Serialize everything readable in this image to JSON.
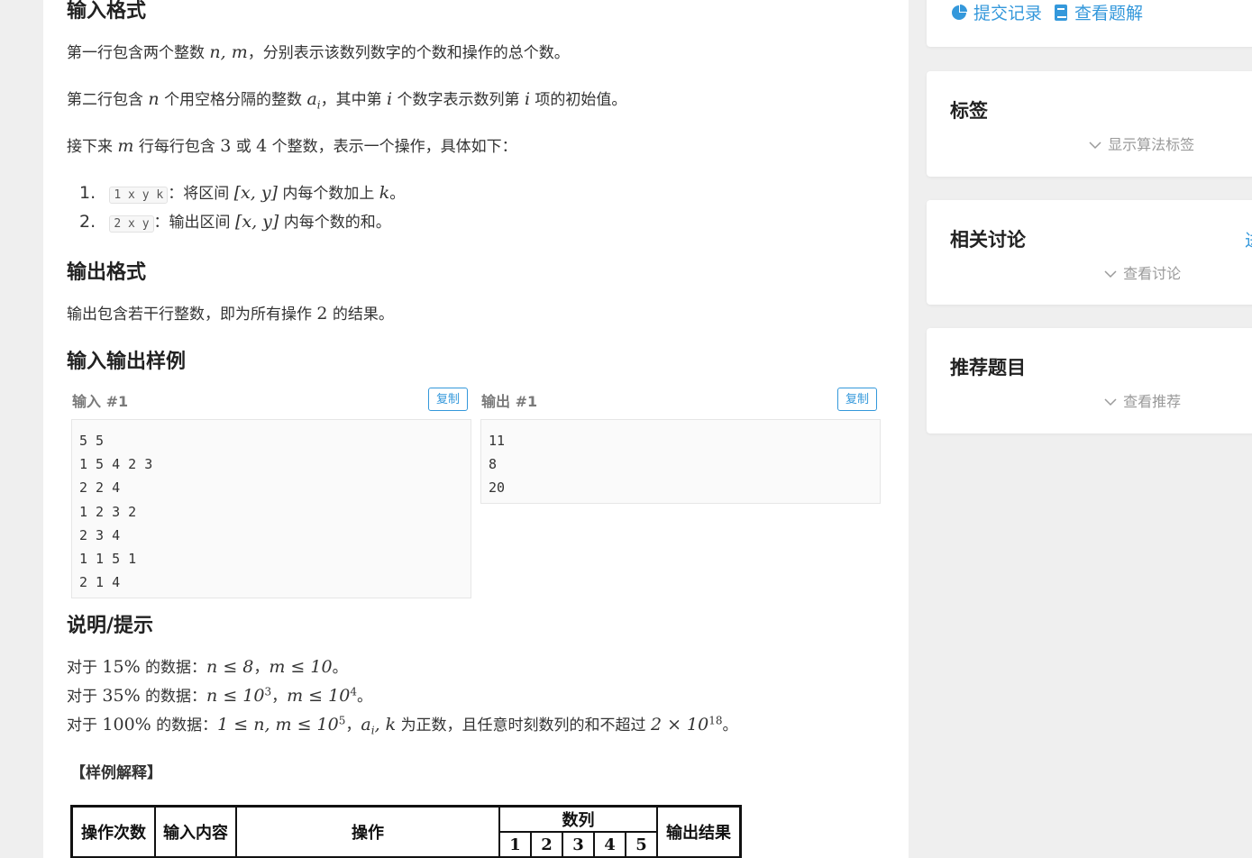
{
  "input_format": {
    "title": "输入格式",
    "line1_a": "第一行包含两个整数",
    "line1_vars": "n, m",
    "line1_b": "，分别表示该数列数字的个数和操作的总个数。",
    "line2_a": "第二行包含",
    "line2_var_n": "n",
    "line2_b": "个用空格分隔的整数",
    "line2_var_a": "a",
    "line2_sub": "i",
    "line2_c": "，其中第",
    "line2_var_i": "i",
    "line2_d": "个数字表示数列第",
    "line2_var_i2": "i",
    "line2_e": "项的初始值。",
    "line3_a": "接下来",
    "line3_var_m": "m",
    "line3_b": "行每行包含",
    "line3_n3": "3",
    "line3_c": "或",
    "line3_n4": "4",
    "line3_d": "个整数，表示一个操作，具体如下：",
    "ops": [
      {
        "num": "1.",
        "code": "1 x y k",
        "text_a": "：将区间",
        "range": "[x, y]",
        "text_b": "内每个数加上",
        "var": "k",
        "text_c": "。"
      },
      {
        "num": "2.",
        "code": "2 x y",
        "text_a": "：输出区间",
        "range": "[x, y]",
        "text_b": "内每个数的和。",
        "var": "",
        "text_c": ""
      }
    ]
  },
  "output_format": {
    "title": "输出格式",
    "line_a": "输出包含若干行整数，即为所有操作",
    "line_num": "2",
    "line_b": "的结果。"
  },
  "samples": {
    "title": "输入输出样例",
    "input_label": "输入 #1",
    "output_label": "输出 #1",
    "copy_label": "复制",
    "input_lines": [
      "5 5",
      "1 5 4 2 3",
      "2 2 4",
      "1 2 3 2",
      "2 3 4",
      "1 1 5 1",
      "2 1 4"
    ],
    "output_lines": [
      "11",
      "8",
      "20"
    ]
  },
  "hint": {
    "title": "说明/提示",
    "r1_a": "对于",
    "r1_pct": "15%",
    "r1_b": "的数据：",
    "r1_m1": "n ≤ 8",
    "r1_sep": "，",
    "r1_m2": "m ≤ 10",
    "r1_end": "。",
    "r2_a": "对于",
    "r2_pct": "35%",
    "r2_b": "的数据：",
    "r2_m1": "n ≤ 10",
    "r2_e1": "3",
    "r2_sep": "，",
    "r2_m2": "m ≤ 10",
    "r2_e2": "4",
    "r2_end": "。",
    "r3_a": "对于",
    "r3_pct": "100%",
    "r3_b": "的数据：",
    "r3_m1": "1 ≤ n, m ≤ 10",
    "r3_e1": "5",
    "r3_sep": "，",
    "r3_m2": "a",
    "r3_sub": "i",
    "r3_m3": ", k",
    "r3_c": "为正数，且任意时刻数列的和不超过",
    "r3_m4": "2 × 10",
    "r3_e2": "18",
    "r3_end": "。",
    "sample_explain": "【样例解释】"
  },
  "explain_table": {
    "col_times": "操作次数",
    "col_input": "输入内容",
    "col_op": "操作",
    "col_seq": "数列",
    "col_out": "输出结果",
    "seq_cols": [
      "1",
      "2",
      "3",
      "4",
      "5"
    ]
  },
  "sidebar": {
    "submissions": "提交记录",
    "solutions": "查看题解",
    "tags_title": "标签",
    "tags_toggle": "显示算法标签",
    "discuss_title": "相关讨论",
    "discuss_toggle": "查看讨论",
    "discuss_more": "进",
    "recommend_title": "推荐题目",
    "recommend_toggle": "查看推荐",
    "accent": "#3498db"
  }
}
